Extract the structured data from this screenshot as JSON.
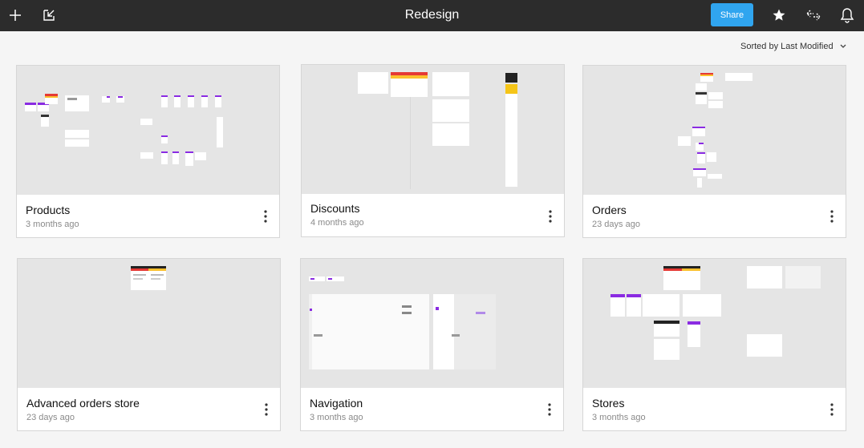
{
  "topbar": {
    "title": "Redesign",
    "share_label": "Share",
    "icons": [
      "plus-icon",
      "import-icon",
      "star-icon",
      "present-icon",
      "bell-icon"
    ]
  },
  "sort": {
    "label": "Sorted by Last Modified",
    "icon": "chevron-down-icon"
  },
  "files": [
    {
      "name": "Products",
      "modified": "3 months ago"
    },
    {
      "name": "Discounts",
      "modified": "4 months ago"
    },
    {
      "name": "Orders",
      "modified": "23 days ago"
    },
    {
      "name": "Advanced orders store",
      "modified": "23 days ago"
    },
    {
      "name": "Navigation",
      "modified": "3 months ago"
    },
    {
      "name": "Stores",
      "modified": "3 months ago"
    }
  ],
  "colors": {
    "topbar": "#2c2c2c",
    "accent": "#30a5ef",
    "purple": "#8a2be2",
    "thumb_bg": "#e5e5e5"
  }
}
